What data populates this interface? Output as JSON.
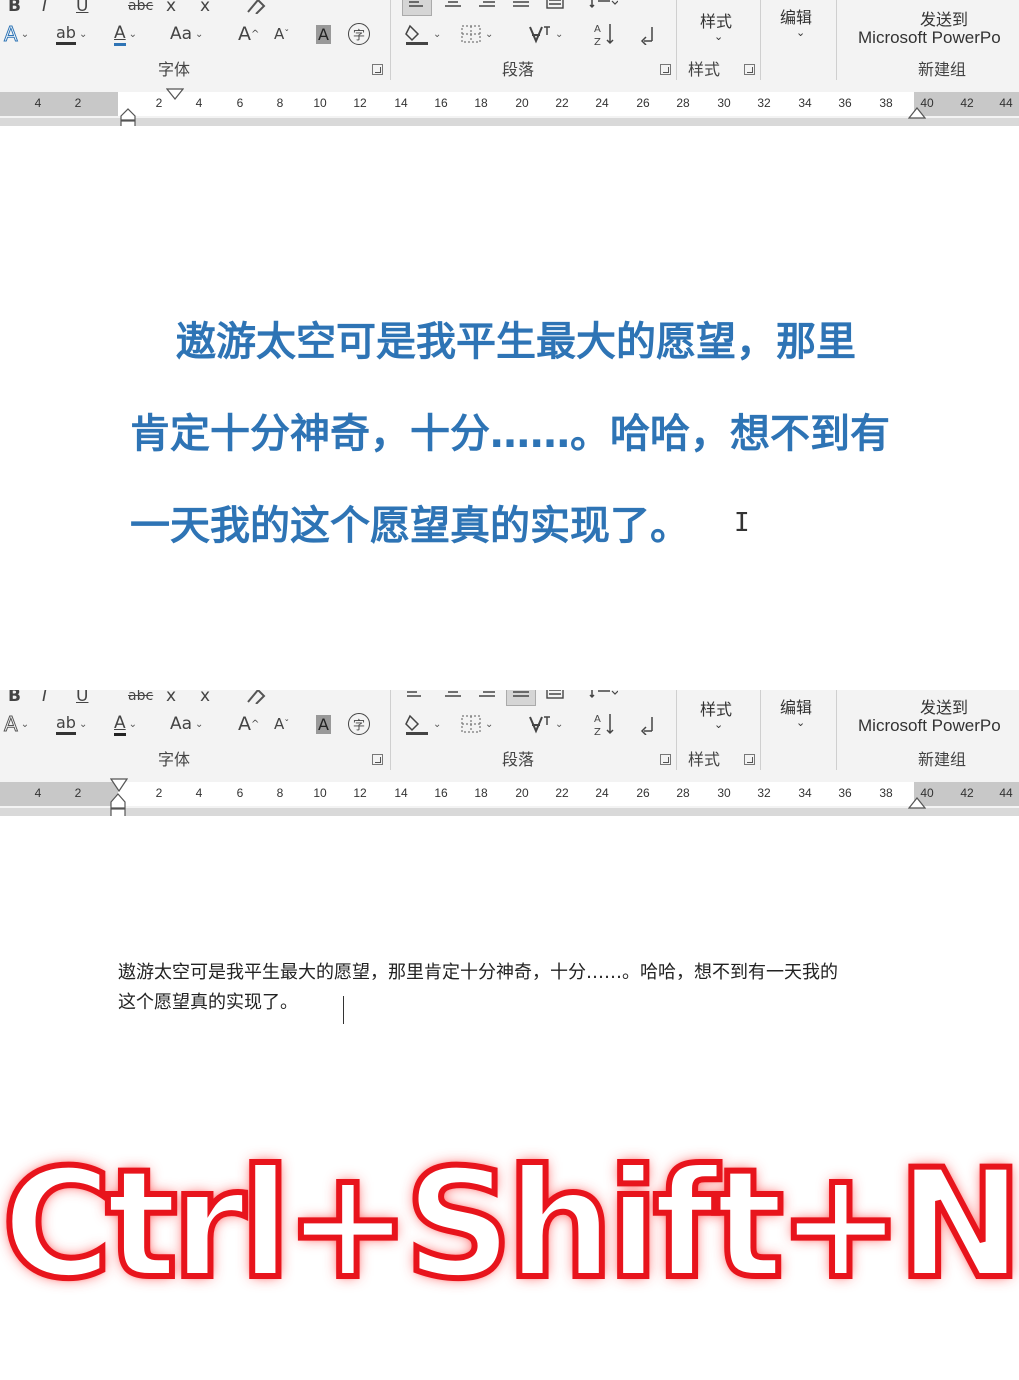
{
  "ribbon": {
    "font_group_label": "字体",
    "paragraph_group_label": "段落",
    "styles_group_label": "样式",
    "styles_button_label": "样式",
    "editing_button_label": "编辑",
    "send_to_label": "发送到",
    "send_to_target": "Microsoft PowerPo",
    "new_group_label": "新建组",
    "font_case_label": "Aa",
    "grow_font": "A",
    "shrink_font": "A",
    "char_shading": "A",
    "enclose_char": "字",
    "font_color": "A",
    "text_effects": "A",
    "highlight": "ab",
    "row0_bold": "B",
    "row0_italic": "I",
    "row0_underline": "U",
    "row0_strike": "abc",
    "row0_sub": "x",
    "row0_sup": "x"
  },
  "ruler": {
    "ticks_left": [
      "4",
      "2"
    ],
    "ticks_right": [
      "2",
      "4",
      "6",
      "8",
      "10",
      "12",
      "14",
      "16",
      "18",
      "20",
      "22",
      "24",
      "26",
      "28",
      "30",
      "32",
      "34",
      "36",
      "38",
      "40",
      "42",
      "44"
    ]
  },
  "document_top": {
    "line1": "遨游太空可是我平生最大的愿望，那里",
    "line2": "肯定十分神奇，十分……。哈哈，想不到有",
    "line3": "一天我的这个愿望真的实现了。"
  },
  "document_bottom": {
    "line1": "遨游太空可是我平生最大的愿望，那里肯定十分神奇，十分……。哈哈，想不到有一天我的",
    "line2": "这个愿望真的实现了。"
  },
  "overlay": {
    "shortcut": "Ctrl+Shift+N"
  },
  "colors": {
    "heading_blue": "#2e74b5",
    "shortcut_red": "#e8141c"
  }
}
